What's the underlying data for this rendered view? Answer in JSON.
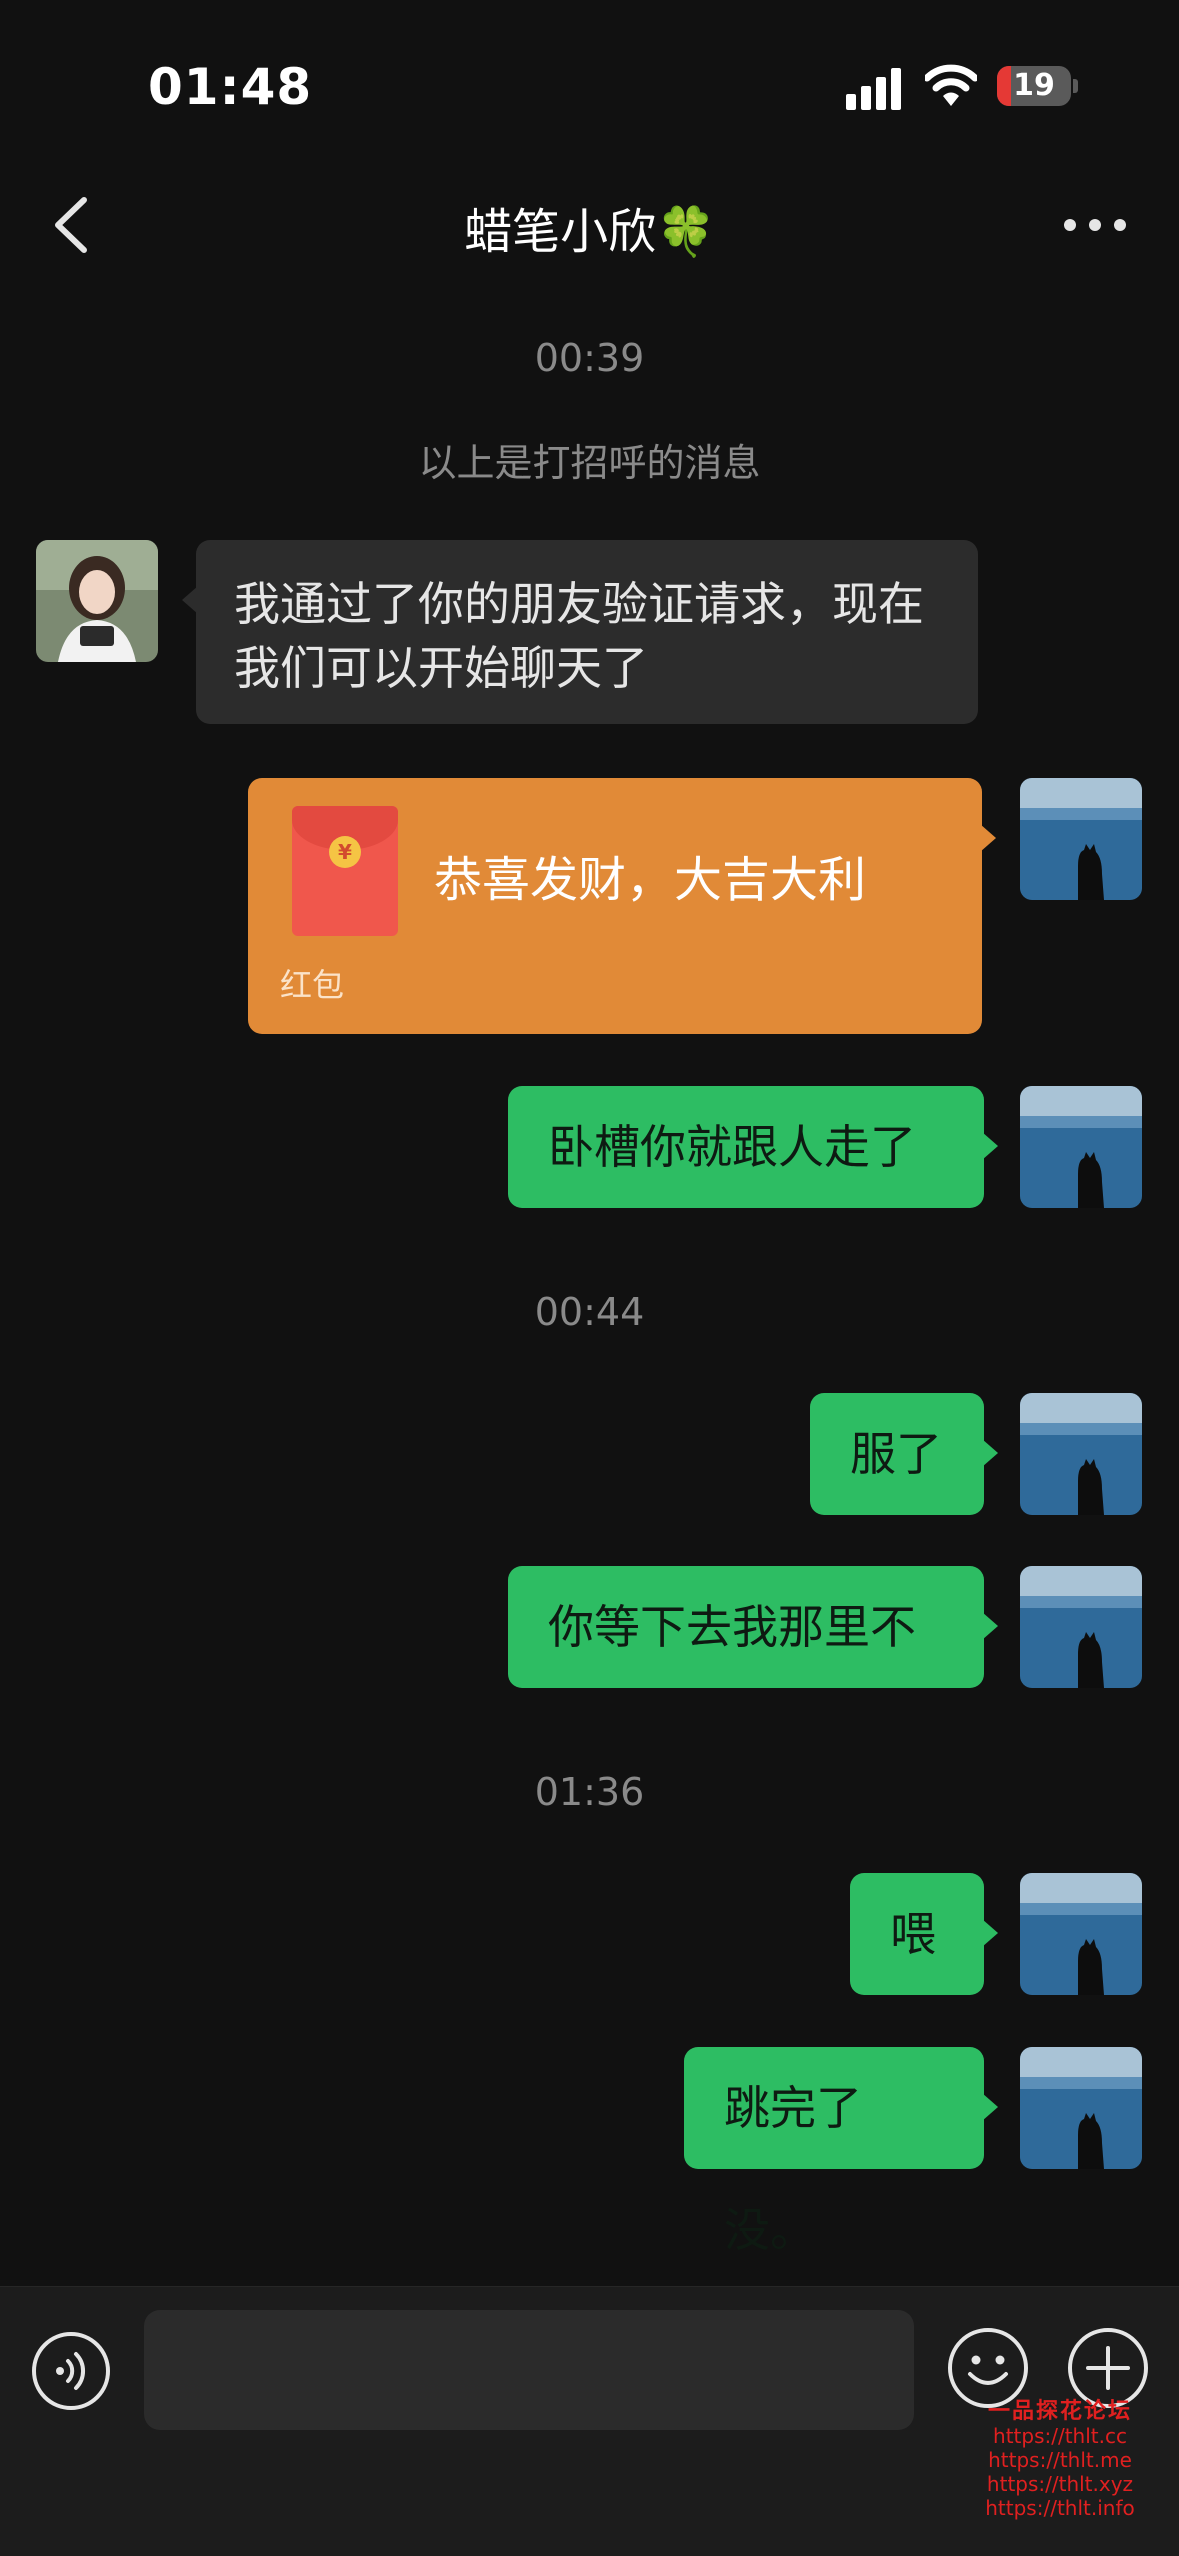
{
  "status_bar": {
    "time": "01:48",
    "battery_level": "19",
    "battery_fraction": 0.19,
    "battery_color": "#e53935"
  },
  "nav": {
    "title": "蜡笔小欣🍀"
  },
  "messages": {
    "ts1": "00:39",
    "system_note": "以上是打招呼的消息",
    "m1": "我通过了你的朋友验证请求，现在我们可以开始聊天了",
    "red_packet": {
      "title": "恭喜发财，大吉大利",
      "label": "红包"
    },
    "m2": "卧槽你就跟人走了",
    "ts2": "00:44",
    "m3": "服了",
    "m4": "你等下去我那里不",
    "ts3": "01:36",
    "m5": "喂",
    "m6": "跳完了没。"
  },
  "input": {
    "value": "",
    "placeholder": ""
  },
  "icons": {
    "voice": "voice-icon",
    "emoji": "emoji-icon",
    "plus": "plus-icon",
    "back": "chevron-left-icon",
    "more": "more-icon"
  },
  "colors": {
    "sent_bubble": "#2dbd63",
    "received_bubble": "#2c2c2c",
    "red_packet": "#e18a37"
  },
  "watermark": {
    "title": "一品探花论坛",
    "line1": "https://thlt.cc",
    "line2": "https://thlt.me",
    "line3": "https://thlt.xyz",
    "line4": "https://thlt.info"
  }
}
